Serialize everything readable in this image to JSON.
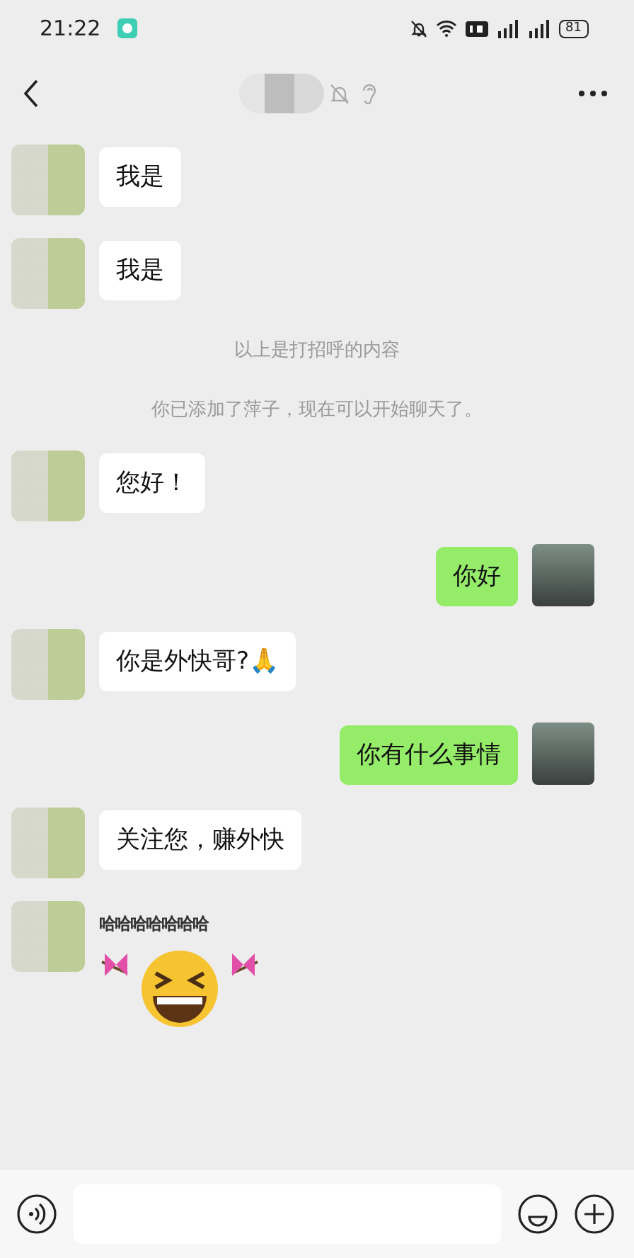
{
  "status_bar": {
    "time": "21:22",
    "battery": "81"
  },
  "messages": [
    {
      "kind": "text",
      "outgoing": false,
      "text": "我是"
    },
    {
      "kind": "text",
      "outgoing": false,
      "text": "我是"
    },
    {
      "kind": "system",
      "text": "以上是打招呼的内容"
    },
    {
      "kind": "system",
      "text": "你已添加了萍子，现在可以开始聊天了。"
    },
    {
      "kind": "text",
      "outgoing": false,
      "text": "您好！"
    },
    {
      "kind": "text",
      "outgoing": true,
      "text": "你好"
    },
    {
      "kind": "text",
      "outgoing": false,
      "text": "你是外快哥?🙏"
    },
    {
      "kind": "text",
      "outgoing": true,
      "text": "你有什么事情"
    },
    {
      "kind": "text",
      "outgoing": false,
      "text": "关注您，赚外快"
    },
    {
      "kind": "sticker",
      "outgoing": false,
      "text": "哈哈哈哈哈哈哈"
    }
  ]
}
